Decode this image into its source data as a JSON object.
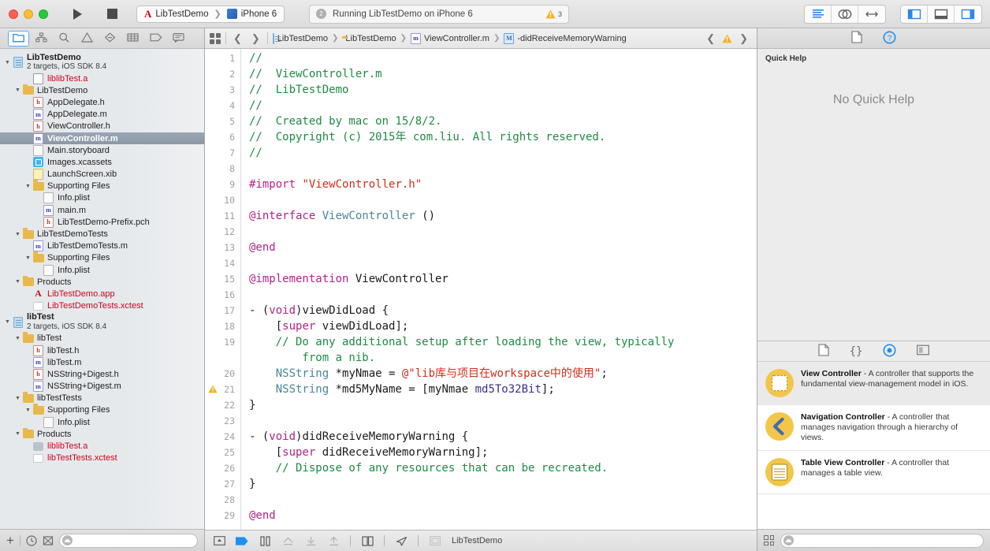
{
  "toolbar": {
    "run_label": "Run",
    "stop_label": "Stop",
    "scheme": "LibTestDemo",
    "destination": "iPhone 6",
    "status_text": "Running LibTestDemo on iPhone 6",
    "status_badge": "2",
    "warning_count": "3",
    "editor_standard": "standard-editor",
    "editor_assistant": "assistant-editor",
    "editor_version": "version-editor",
    "view_navigator": "toggle-navigator",
    "view_debug": "toggle-debug-area",
    "view_utilities": "toggle-utilities"
  },
  "navigator": {
    "tabs": [
      {
        "name": "project-navigator",
        "icon": "folder-icon",
        "active": true
      },
      {
        "name": "symbol-navigator",
        "icon": "hierarchy-icon",
        "active": false
      },
      {
        "name": "find-navigator",
        "icon": "search-icon",
        "active": false
      },
      {
        "name": "issue-navigator",
        "icon": "warning-triangle-icon",
        "active": false
      },
      {
        "name": "test-navigator",
        "icon": "diamond-minus-icon",
        "active": false
      },
      {
        "name": "debug-navigator",
        "icon": "grid-lines-icon",
        "active": false
      },
      {
        "name": "breakpoint-navigator",
        "icon": "tag-icon",
        "active": false
      },
      {
        "name": "report-navigator",
        "icon": "speech-bubble-icon",
        "active": false
      }
    ],
    "tree": [
      {
        "depth": 0,
        "label": "LibTestDemo",
        "sub": "2 targets, iOS SDK 8.4",
        "icon": "project-icon",
        "bold": true,
        "twisty": "open",
        "group": true
      },
      {
        "depth": 2,
        "label": "liblibTest.a",
        "icon": "file-plain-icon",
        "red": true,
        "twisty": ""
      },
      {
        "depth": 1,
        "label": "LibTestDemo",
        "icon": "folder-icon",
        "twisty": "open"
      },
      {
        "depth": 2,
        "label": "AppDelegate.h",
        "icon": "header-icon",
        "twisty": ""
      },
      {
        "depth": 2,
        "label": "AppDelegate.m",
        "icon": "source-icon",
        "twisty": ""
      },
      {
        "depth": 2,
        "label": "ViewController.h",
        "icon": "header-icon",
        "twisty": ""
      },
      {
        "depth": 2,
        "label": "ViewController.m",
        "icon": "source-icon",
        "twisty": "",
        "selected": true
      },
      {
        "depth": 2,
        "label": "Main.storyboard",
        "icon": "storyboard-icon",
        "twisty": ""
      },
      {
        "depth": 2,
        "label": "Images.xcassets",
        "icon": "xcassets-icon",
        "twisty": ""
      },
      {
        "depth": 2,
        "label": "LaunchScreen.xib",
        "icon": "xib-icon",
        "twisty": ""
      },
      {
        "depth": 2,
        "label": "Supporting Files",
        "icon": "folder-icon",
        "twisty": "open"
      },
      {
        "depth": 3,
        "label": "Info.plist",
        "icon": "plist-icon",
        "twisty": ""
      },
      {
        "depth": 3,
        "label": "main.m",
        "icon": "source-icon",
        "twisty": ""
      },
      {
        "depth": 3,
        "label": "LibTestDemo-Prefix.pch",
        "icon": "header-icon",
        "twisty": ""
      },
      {
        "depth": 1,
        "label": "LibTestDemoTests",
        "icon": "folder-icon",
        "twisty": "open"
      },
      {
        "depth": 2,
        "label": "LibTestDemoTests.m",
        "icon": "source-icon",
        "twisty": ""
      },
      {
        "depth": 2,
        "label": "Supporting Files",
        "icon": "folder-icon",
        "twisty": "open"
      },
      {
        "depth": 3,
        "label": "Info.plist",
        "icon": "plist-icon",
        "twisty": ""
      },
      {
        "depth": 1,
        "label": "Products",
        "icon": "folder-icon",
        "twisty": "open"
      },
      {
        "depth": 2,
        "label": "LibTestDemo.app",
        "icon": "app-icon",
        "red": true,
        "twisty": ""
      },
      {
        "depth": 2,
        "label": "LibTestDemoTests.xctest",
        "icon": "xctest-icon",
        "red": true,
        "twisty": ""
      },
      {
        "depth": 0,
        "label": "libTest",
        "sub": "2 targets, iOS SDK 8.4",
        "icon": "project-icon",
        "bold": true,
        "twisty": "open",
        "group": true
      },
      {
        "depth": 1,
        "label": "libTest",
        "icon": "folder-icon",
        "twisty": "open"
      },
      {
        "depth": 2,
        "label": "libTest.h",
        "icon": "header-icon",
        "twisty": ""
      },
      {
        "depth": 2,
        "label": "libTest.m",
        "icon": "source-icon",
        "twisty": ""
      },
      {
        "depth": 2,
        "label": "NSString+Digest.h",
        "icon": "header-icon",
        "twisty": ""
      },
      {
        "depth": 2,
        "label": "NSString+Digest.m",
        "icon": "source-icon",
        "twisty": ""
      },
      {
        "depth": 1,
        "label": "libTestTests",
        "icon": "folder-icon",
        "twisty": "open"
      },
      {
        "depth": 2,
        "label": "Supporting Files",
        "icon": "folder-icon",
        "twisty": "open"
      },
      {
        "depth": 3,
        "label": "Info.plist",
        "icon": "plist-icon",
        "twisty": ""
      },
      {
        "depth": 1,
        "label": "Products",
        "icon": "folder-icon",
        "twisty": "open"
      },
      {
        "depth": 2,
        "label": "liblibTest.a",
        "icon": "library-icon",
        "red": true,
        "twisty": ""
      },
      {
        "depth": 2,
        "label": "libTestTests.xctest",
        "icon": "xctest-icon",
        "red": true,
        "twisty": ""
      }
    ],
    "bottom": {
      "add_label": "+",
      "recent_label": "recent-files-filter",
      "sourcectl_label": "source-control-filter",
      "filter_placeholder": ""
    }
  },
  "editor": {
    "breadcrumbs": [
      {
        "label": "LibTestDemo",
        "icon": "project-icon"
      },
      {
        "label": "LibTestDemo",
        "icon": "folder-icon"
      },
      {
        "label": "ViewController.m",
        "icon": "source-icon"
      },
      {
        "label": "-didReceiveMemoryWarning",
        "icon": "method-icon"
      }
    ],
    "code_lines": [
      {
        "n": "1",
        "warn": false,
        "tokens": [
          {
            "t": "//",
            "c": "c-com"
          }
        ]
      },
      {
        "n": "2",
        "warn": false,
        "tokens": [
          {
            "t": "//  ViewController.m",
            "c": "c-com"
          }
        ]
      },
      {
        "n": "3",
        "warn": false,
        "tokens": [
          {
            "t": "//  LibTestDemo",
            "c": "c-com"
          }
        ]
      },
      {
        "n": "4",
        "warn": false,
        "tokens": [
          {
            "t": "//",
            "c": "c-com"
          }
        ]
      },
      {
        "n": "5",
        "warn": false,
        "tokens": [
          {
            "t": "//  Created by mac on 15/8/2.",
            "c": "c-com"
          }
        ]
      },
      {
        "n": "6",
        "warn": false,
        "tokens": [
          {
            "t": "//  Copyright (c) 2015年 com.liu. All rights reserved.",
            "c": "c-com"
          }
        ]
      },
      {
        "n": "7",
        "warn": false,
        "tokens": [
          {
            "t": "//",
            "c": "c-com"
          }
        ]
      },
      {
        "n": "8",
        "warn": false,
        "tokens": []
      },
      {
        "n": "9",
        "warn": false,
        "tokens": [
          {
            "t": "#import ",
            "c": "c-pre"
          },
          {
            "t": "\"ViewController.h\"",
            "c": "c-str"
          }
        ]
      },
      {
        "n": "10",
        "warn": false,
        "tokens": []
      },
      {
        "n": "11",
        "warn": false,
        "tokens": [
          {
            "t": "@interface ",
            "c": "c-kw"
          },
          {
            "t": "ViewController",
            "c": "c-typ"
          },
          {
            "t": " ()",
            "c": "c-pln"
          }
        ]
      },
      {
        "n": "12",
        "warn": false,
        "tokens": []
      },
      {
        "n": "13",
        "warn": false,
        "tokens": [
          {
            "t": "@end",
            "c": "c-kw"
          }
        ]
      },
      {
        "n": "14",
        "warn": false,
        "tokens": []
      },
      {
        "n": "15",
        "warn": false,
        "tokens": [
          {
            "t": "@implementation ",
            "c": "c-kw"
          },
          {
            "t": "ViewController",
            "c": "c-pln"
          }
        ]
      },
      {
        "n": "16",
        "warn": false,
        "tokens": []
      },
      {
        "n": "17",
        "warn": false,
        "tokens": [
          {
            "t": "- (",
            "c": "c-pln"
          },
          {
            "t": "void",
            "c": "c-kw"
          },
          {
            "t": ")viewDidLoad {",
            "c": "c-pln"
          }
        ]
      },
      {
        "n": "18",
        "warn": false,
        "tokens": [
          {
            "t": "    [",
            "c": "c-pln"
          },
          {
            "t": "super",
            "c": "c-kw"
          },
          {
            "t": " viewDidLoad];",
            "c": "c-pln"
          }
        ]
      },
      {
        "n": "19",
        "warn": false,
        "tokens": [
          {
            "t": "    // Do any additional setup after loading the view, typically",
            "c": "c-com"
          }
        ]
      },
      {
        "n": "",
        "warn": false,
        "tokens": [
          {
            "t": "        from a nib.",
            "c": "c-com"
          }
        ]
      },
      {
        "n": "20",
        "warn": false,
        "tokens": [
          {
            "t": "    ",
            "c": "c-pln"
          },
          {
            "t": "NSString",
            "c": "c-typ"
          },
          {
            "t": " *myNmae = ",
            "c": "c-pln"
          },
          {
            "t": "@\"lib库与项目在workspace中的使用\"",
            "c": "c-str"
          },
          {
            "t": ";",
            "c": "c-pln"
          }
        ]
      },
      {
        "n": "21",
        "warn": true,
        "tokens": [
          {
            "t": "    ",
            "c": "c-pln"
          },
          {
            "t": "NSString",
            "c": "c-typ"
          },
          {
            "t": " *md5MyName = [myNmae ",
            "c": "c-pln"
          },
          {
            "t": "md5To32Bit",
            "c": "c-mtd"
          },
          {
            "t": "];",
            "c": "c-pln"
          }
        ]
      },
      {
        "n": "22",
        "warn": false,
        "tokens": [
          {
            "t": "}",
            "c": "c-pln"
          }
        ]
      },
      {
        "n": "23",
        "warn": false,
        "tokens": []
      },
      {
        "n": "24",
        "warn": false,
        "tokens": [
          {
            "t": "- (",
            "c": "c-pln"
          },
          {
            "t": "void",
            "c": "c-kw"
          },
          {
            "t": ")didReceiveMemoryWarning {",
            "c": "c-pln"
          }
        ]
      },
      {
        "n": "25",
        "warn": false,
        "tokens": [
          {
            "t": "    [",
            "c": "c-pln"
          },
          {
            "t": "super",
            "c": "c-kw"
          },
          {
            "t": " didReceiveMemoryWarning];",
            "c": "c-pln"
          }
        ]
      },
      {
        "n": "26",
        "warn": false,
        "tokens": [
          {
            "t": "    // Dispose of any resources that can be recreated.",
            "c": "c-com"
          }
        ]
      },
      {
        "n": "27",
        "warn": false,
        "tokens": [
          {
            "t": "}",
            "c": "c-pln"
          }
        ]
      },
      {
        "n": "28",
        "warn": false,
        "tokens": []
      },
      {
        "n": "29",
        "warn": false,
        "tokens": [
          {
            "t": "@end",
            "c": "c-kw"
          }
        ]
      }
    ],
    "bottom_bar": {
      "scheme_label": "LibTestDemo",
      "icons": [
        "show-hide-icon",
        "breakpoint-icon",
        "pause-icon",
        "step-over-icon",
        "step-into-icon",
        "step-out-icon",
        "view-hierarchy-icon",
        "location-icon",
        "memory-gauge-icon"
      ]
    }
  },
  "inspector": {
    "tabs": [
      {
        "name": "file-inspector",
        "icon": "document-icon",
        "active": false
      },
      {
        "name": "quick-help-inspector",
        "icon": "question-circle-icon",
        "active": true
      }
    ],
    "quick_help_title": "Quick Help",
    "quick_help_body": "No Quick Help",
    "library_tabs": [
      {
        "name": "file-template-library",
        "icon": "document-icon",
        "active": false
      },
      {
        "name": "code-snippet-library",
        "icon": "braces-icon",
        "active": false
      },
      {
        "name": "object-library",
        "icon": "target-circle-icon",
        "active": true
      },
      {
        "name": "media-library",
        "icon": "media-icon",
        "active": false
      }
    ],
    "library_items": [
      {
        "title": "View Controller",
        "desc": " - A controller that supports the fundamental view-management model in iOS.",
        "icon": "view-controller-icon",
        "selected": true
      },
      {
        "title": "Navigation Controller",
        "desc": " - A controller that manages navigation through a hierarchy of views.",
        "icon": "navigation-controller-icon",
        "selected": false
      },
      {
        "title": "Table View Controller",
        "desc": " - A controller that manages a table view.",
        "icon": "table-view-controller-icon",
        "selected": false
      }
    ],
    "search_placeholder": ""
  }
}
